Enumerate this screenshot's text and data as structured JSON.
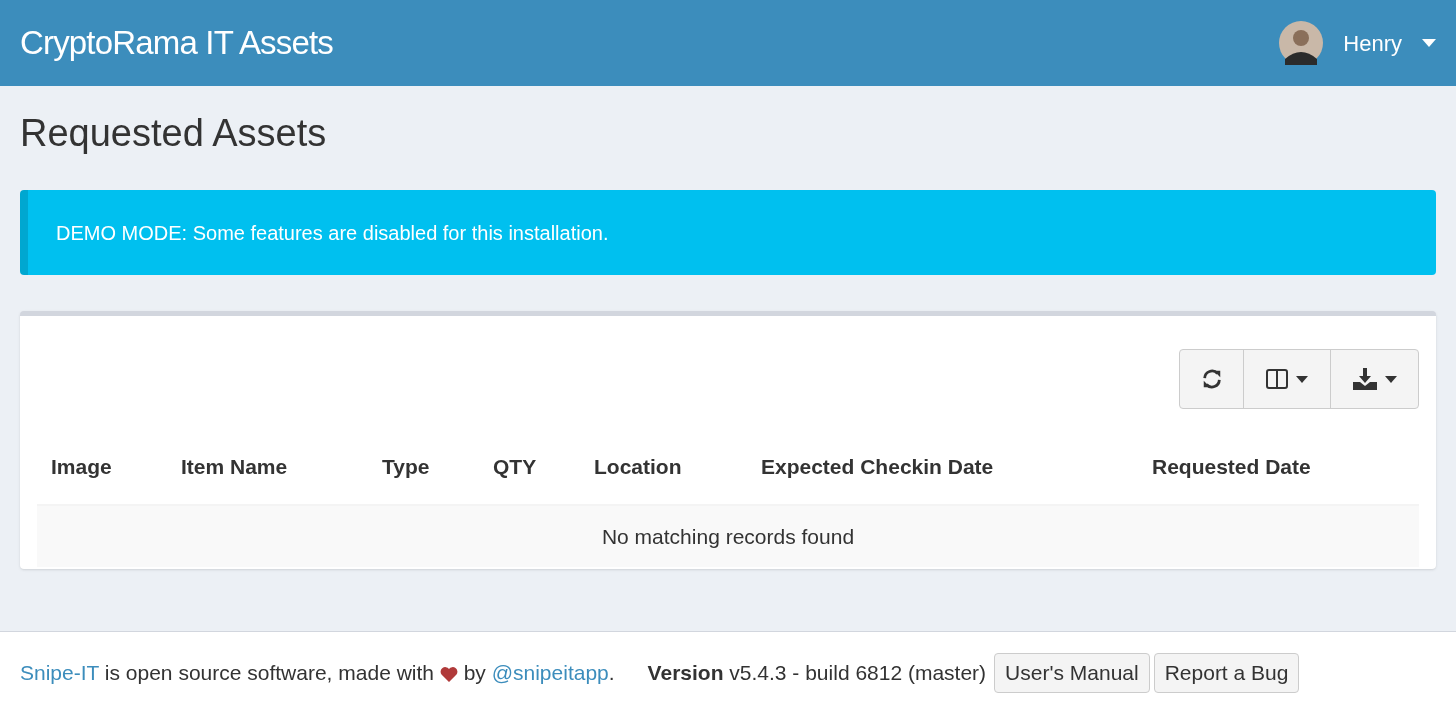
{
  "navbar": {
    "brand": "CryptoRama IT Assets",
    "user": {
      "name": "Henry"
    }
  },
  "page_title": "Requested Assets",
  "alert": "DEMO MODE: Some features are disabled for this installation.",
  "table": {
    "columns": [
      "Image",
      "Item Name",
      "Type",
      "QTY",
      "Location",
      "Expected Checkin Date",
      "Requested Date"
    ],
    "empty_message": "No matching records found"
  },
  "footer": {
    "link_1": "Snipe-IT",
    "text_1": " is open source software, made with ",
    "text_2": " by ",
    "link_2": "@snipeitapp",
    "text_3": ".",
    "version": "**Version** v5.4.3 - build 6812 (master)",
    "buttons": [
      "User's Manual",
      "Report a Bug"
    ]
  }
}
